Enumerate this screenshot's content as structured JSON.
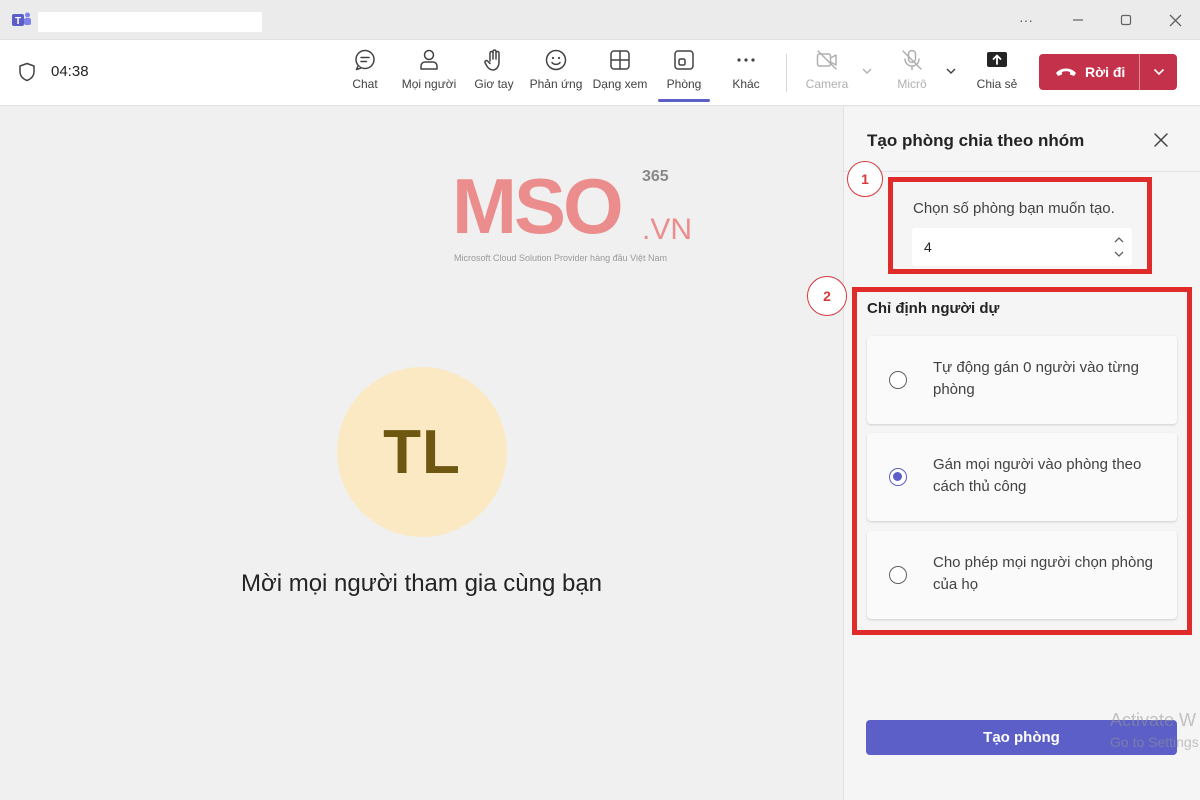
{
  "titlebar": {
    "logo_icon": "teams-logo-icon",
    "more_label": "···"
  },
  "toolbar": {
    "timer": "04:38",
    "items": [
      {
        "label": "Chat",
        "icon": "chat-icon"
      },
      {
        "label": "Mọi người",
        "icon": "people-icon"
      },
      {
        "label": "Giơ tay",
        "icon": "raise-hand-icon"
      },
      {
        "label": "Phản ứng",
        "icon": "reaction-icon"
      },
      {
        "label": "Dạng xem",
        "icon": "view-icon"
      },
      {
        "label": "Phòng",
        "icon": "rooms-icon",
        "active": true
      },
      {
        "label": "Khác",
        "icon": "more-icon"
      },
      {
        "label": "Camera",
        "icon": "camera-off-icon",
        "disabled": true
      },
      {
        "label": "Micrô",
        "icon": "mic-off-icon",
        "disabled": true
      },
      {
        "label": "Chia sẻ",
        "icon": "share-icon"
      }
    ],
    "leave_label": "Rời đi"
  },
  "stage": {
    "logo_text": "MSO",
    "logo_suffix": ".VN",
    "logo_sup": "365",
    "logo_tagline": "Microsoft Cloud Solution Provider hàng đầu Việt Nam",
    "avatar_initials": "TL",
    "invite_text": "Mời mọi người tham gia cùng bạn"
  },
  "panel": {
    "title": "Tạo phòng chia theo nhóm",
    "callout_1": "1",
    "callout_2": "2",
    "room_count_label": "Chọn số phòng bạn muốn tạo.",
    "room_count_value": "4",
    "assign_title": "Chỉ định người dự",
    "options": [
      {
        "label": "Tự động gán 0 người vào từng phòng",
        "selected": false
      },
      {
        "label": "Gán mọi người vào phòng theo cách thủ công",
        "selected": true
      },
      {
        "label": "Cho phép mọi người chọn phòng của họ",
        "selected": false
      }
    ],
    "create_button": "Tạo phòng"
  },
  "watermark": {
    "line1": "Activate W",
    "line2": "Go to Settings"
  },
  "colors": {
    "accent": "#5b5fc7",
    "leave": "#c4314b",
    "highlight": "#e02b2b",
    "logo": "#ec8d8d"
  }
}
